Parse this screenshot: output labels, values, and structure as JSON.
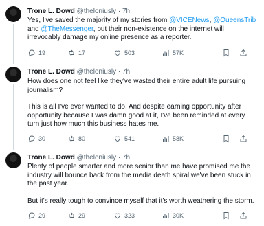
{
  "tweets": [
    {
      "name": "Trone L. Dowd",
      "handle": "@theloniusly",
      "sep": "·",
      "time": "7h",
      "paragraphs": [
        [
          {
            "t": "Yes, I've saved the majority of my stories from "
          },
          {
            "t": "@VICENews",
            "link": true
          },
          {
            "t": ", "
          },
          {
            "t": "@QueensTrib",
            "link": true
          },
          {
            "t": " and "
          },
          {
            "t": "@TheMessenger",
            "link": true
          },
          {
            "t": ", but their non-existence on the internet will irrevocably damage my online presence as a reporter."
          }
        ]
      ],
      "replies": "19",
      "retweets": "17",
      "likes": "503",
      "views": "57K"
    },
    {
      "name": "Trone L. Dowd",
      "handle": "@theloniusly",
      "sep": "·",
      "time": "7h",
      "paragraphs": [
        [
          {
            "t": "How does one not feel like they've wasted their entire adult life pursuing journalism?"
          }
        ],
        [
          {
            "t": "This is all I've ever wanted to do. And despite earning opportunity after opportunity because I was damn good at it, I've been reminded at every turn just how much this business hates me."
          }
        ]
      ],
      "replies": "30",
      "retweets": "80",
      "likes": "541",
      "views": "58K"
    },
    {
      "name": "Trone L. Dowd",
      "handle": "@theloniusly",
      "sep": "·",
      "time": "7h",
      "paragraphs": [
        [
          {
            "t": "Plenty of people smarter and more senior than me have promised me the industry will bounce back from the media death spiral we've been stuck in the past year."
          }
        ],
        [
          {
            "t": "But it's really tough to convince myself that it's worth weathering the storm."
          }
        ]
      ],
      "replies": "29",
      "retweets": "29",
      "likes": "323",
      "views": "30K"
    }
  ],
  "icons": {
    "reply": "reply-icon",
    "retweet": "retweet-icon",
    "like": "like-icon",
    "views": "views-icon",
    "bookmark": "bookmark-icon",
    "share": "share-icon"
  },
  "colors": {
    "link": "#1d9bf0",
    "text": "#0f1419",
    "secondary": "#536471",
    "thread_line": "#cfd9de"
  }
}
